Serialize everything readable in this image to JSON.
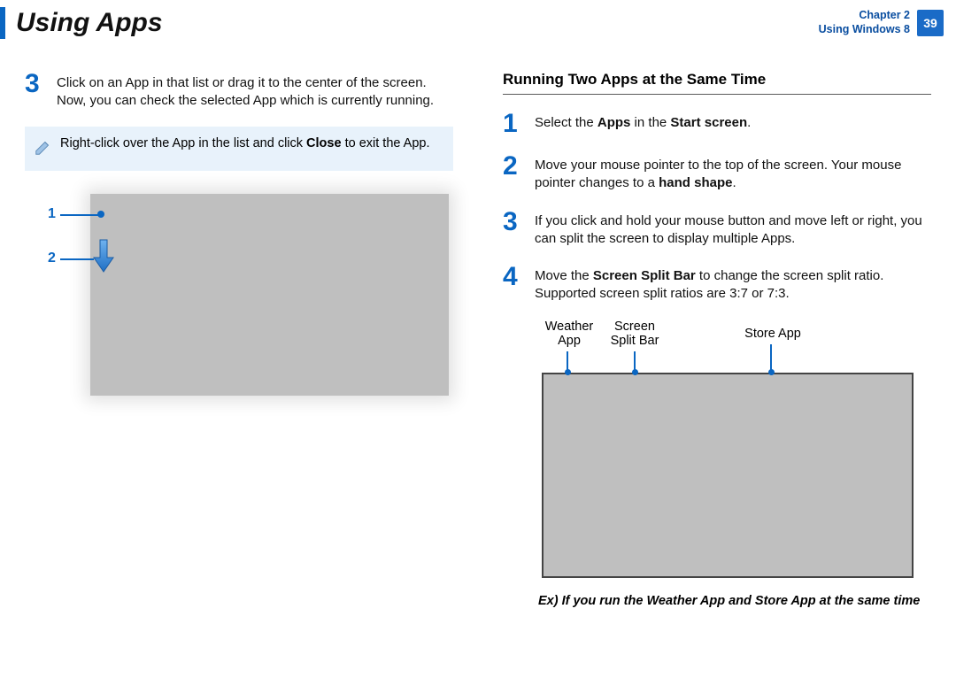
{
  "header": {
    "title": "Using Apps",
    "chapter_line1": "Chapter 2",
    "chapter_line2": "Using Windows 8",
    "page_number": "39"
  },
  "left": {
    "step3_num": "3",
    "step3_text": "Click on an App in that list or drag it to the center of the screen. Now, you can check the selected App which is currently running.",
    "note_pre": "Right-click over the App in the list and click ",
    "note_bold": "Close",
    "note_post": " to exit the App.",
    "callout_1": "1",
    "callout_2": "2"
  },
  "right": {
    "section_title": "Running Two Apps at the Same Time",
    "steps": [
      {
        "num": "1",
        "pre": "Select the ",
        "b1": "Apps",
        "mid": " in the ",
        "b2": "Start screen",
        "post": "."
      },
      {
        "num": "2",
        "pre": "Move your mouse pointer to the top of the screen. Your mouse pointer changes to a ",
        "b1": "hand shape",
        "mid": "",
        "b2": "",
        "post": "."
      },
      {
        "num": "3",
        "pre": "If you click and hold your mouse button and move left or right, you can split the screen to display multiple Apps.",
        "b1": "",
        "mid": "",
        "b2": "",
        "post": ""
      },
      {
        "num": "4",
        "pre": "Move the ",
        "b1": "Screen Split Bar",
        "mid": " to change the screen split ratio. Supported screen split ratios are 3:7 or 7:3.",
        "b2": "",
        "post": ""
      }
    ],
    "labels": {
      "weather": "Weather App",
      "splitbar": "Screen Split Bar",
      "store": "Store App"
    },
    "caption": "Ex) If you run the Weather App and Store App at the same time"
  }
}
